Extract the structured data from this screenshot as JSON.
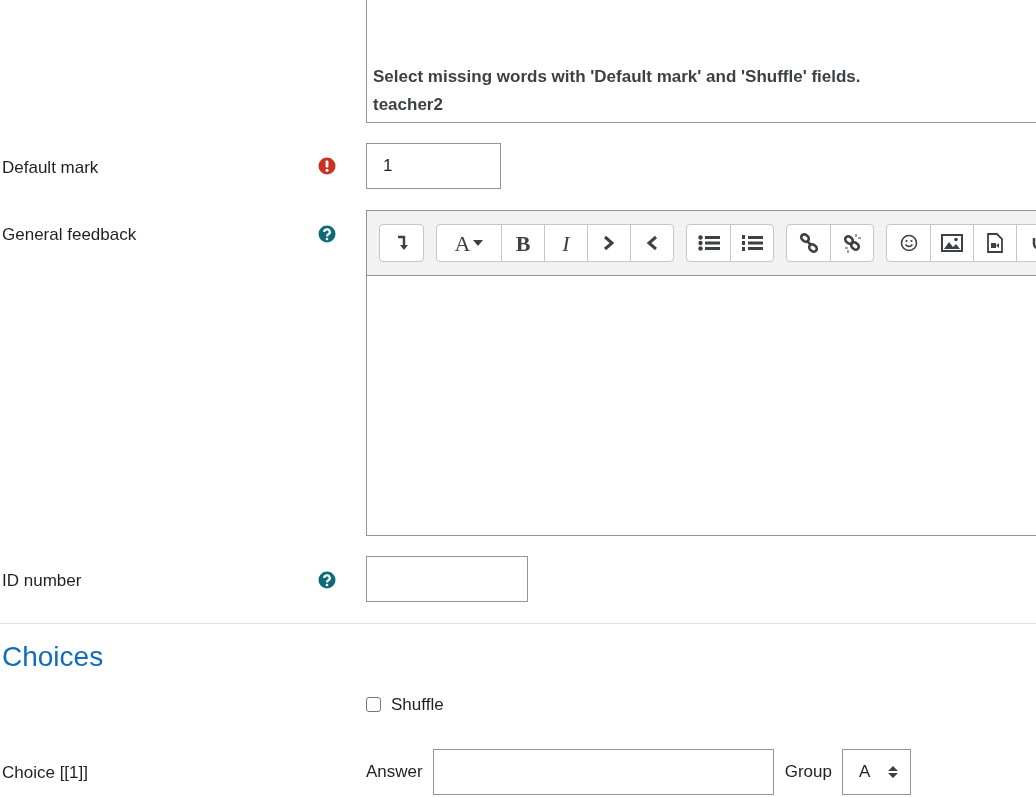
{
  "description_box": {
    "lines": [
      "Select missing words with 'Default mark' and 'Shuffle' fields.",
      "teacher2"
    ]
  },
  "default_mark": {
    "label": "Default mark",
    "value": "1",
    "error": true
  },
  "general_feedback": {
    "label": "General feedback",
    "help": true,
    "toolbar": [
      [
        {
          "kind": "icon"
        }
      ],
      [
        {
          "kind": "glyph",
          "label": "A",
          "caret": true
        },
        {
          "kind": "glyph",
          "label": "B"
        },
        {
          "kind": "glyph",
          "label": "I"
        },
        {
          "kind": "icon"
        },
        {
          "kind": "icon"
        }
      ],
      [
        {
          "kind": "icon"
        },
        {
          "kind": "icon"
        }
      ],
      [
        {
          "kind": "icon"
        },
        {
          "kind": "icon"
        }
      ],
      [
        {
          "kind": "icon"
        },
        {
          "kind": "icon"
        },
        {
          "kind": "icon"
        },
        {
          "kind": "icon"
        }
      ]
    ]
  },
  "id_number": {
    "label": "ID number",
    "help": true
  },
  "choices": {
    "heading": "Choices",
    "shuffle": {
      "label": "Shuffle",
      "checked": false
    },
    "rows": [
      {
        "label": "Choice [[1]]",
        "answer_label": "Answer",
        "group_label": "Group",
        "group": "A"
      }
    ]
  }
}
